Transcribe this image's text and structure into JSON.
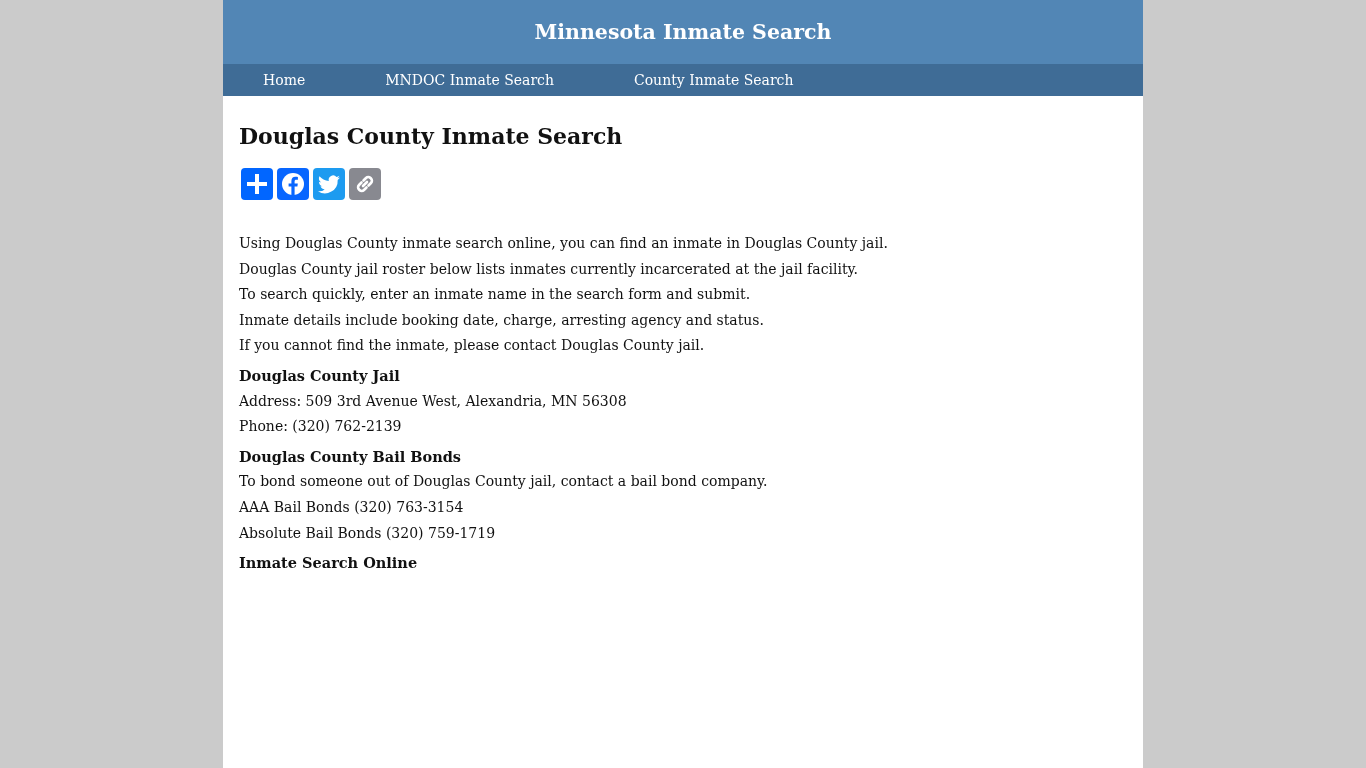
{
  "header": {
    "title": "Minnesota Inmate Search"
  },
  "nav": [
    {
      "label": "Home"
    },
    {
      "label": "MNDOC Inmate Search"
    },
    {
      "label": "County Inmate Search"
    }
  ],
  "page": {
    "title": "Douglas County Inmate Search",
    "share_buttons": [
      {
        "kind": "add"
      },
      {
        "kind": "facebook"
      },
      {
        "kind": "twitter"
      },
      {
        "kind": "copy-link"
      }
    ],
    "intro": [
      "Using Douglas County inmate search online, you can find an inmate in Douglas County jail.",
      "Douglas County jail roster below lists inmates currently incarcerated at the jail facility.",
      "To search quickly, enter an inmate name in the search form and submit.",
      "Inmate details include booking date, charge, arresting agency and status.",
      "If you cannot find the inmate, please contact Douglas County jail."
    ],
    "sections": [
      {
        "heading": "Douglas County Jail",
        "lines": [
          "Address: 509 3rd Avenue West, Alexandria, MN 56308",
          "Phone: (320) 762-2139"
        ]
      },
      {
        "heading": "Douglas County Bail Bonds",
        "lines": [
          "To bond someone out of Douglas County jail, contact a bail bond company.",
          "AAA Bail Bonds (320) 763-3154",
          "Absolute Bail Bonds (320) 759-1719"
        ]
      },
      {
        "heading": "Inmate Search Online"
      }
    ]
  }
}
